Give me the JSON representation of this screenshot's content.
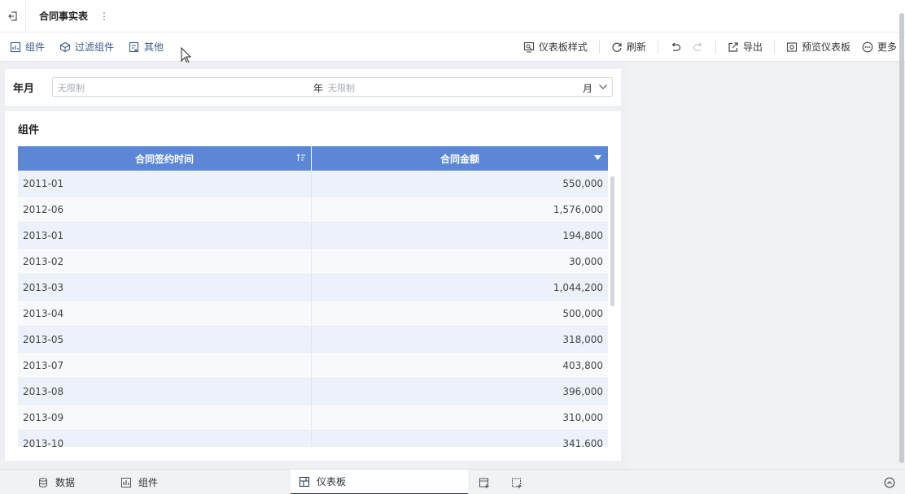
{
  "header": {
    "tab_title": "合同事实表",
    "more_glyph": "⋮"
  },
  "toolbar": {
    "left": [
      {
        "label": "组件",
        "icon": "add-component-icon"
      },
      {
        "label": "过滤组件",
        "icon": "filter-component-icon"
      },
      {
        "label": "其他",
        "icon": "other-icon"
      }
    ],
    "dashboard_style": "仪表板样式",
    "refresh": "刷新",
    "export": "导出",
    "preview": "预览仪表板",
    "more": "更多"
  },
  "filter": {
    "label": "年月",
    "placeholder_year": "无限制",
    "unit_year": "年",
    "placeholder_month": "无限制",
    "unit_month": "月"
  },
  "table_widget": {
    "title": "组件",
    "columns": [
      "合同签约时间",
      "合同金额"
    ],
    "rows": [
      [
        "2011-01",
        "550,000"
      ],
      [
        "2012-06",
        "1,576,000"
      ],
      [
        "2013-01",
        "194,800"
      ],
      [
        "2013-02",
        "30,000"
      ],
      [
        "2013-03",
        "1,044,200"
      ],
      [
        "2013-04",
        "500,000"
      ],
      [
        "2013-05",
        "318,000"
      ],
      [
        "2013-07",
        "403,800"
      ],
      [
        "2013-08",
        "396,000"
      ],
      [
        "2013-09",
        "310,000"
      ],
      [
        "2013-10",
        "341,600"
      ]
    ]
  },
  "bottom_tabs": {
    "data": "数据",
    "component": "组件",
    "dashboard": "仪表板"
  },
  "colors": {
    "header_bg": "#5b87d6",
    "accent_link": "#3d5a8a"
  }
}
